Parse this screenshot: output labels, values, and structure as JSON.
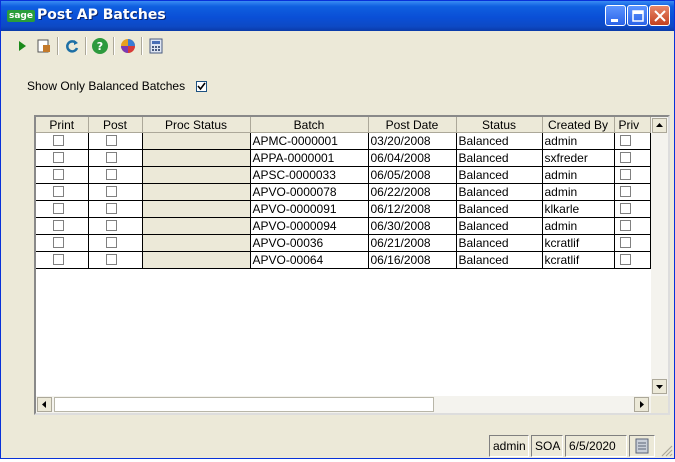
{
  "window": {
    "title": "Post AP Batches",
    "logo_text": "sage"
  },
  "toolbar": {
    "buttons": [
      "play-icon",
      "print-preview-icon",
      "refresh-icon",
      "help-icon",
      "color-wheel-icon",
      "calculator-icon"
    ]
  },
  "filter": {
    "label": "Show Only Balanced Batches",
    "checked": true
  },
  "grid": {
    "columns": [
      "Print",
      "Post",
      "Proc Status",
      "Batch",
      "Post Date",
      "Status",
      "Created By",
      "Priv"
    ],
    "rows": [
      {
        "batch": "APMC-0000001",
        "post_date": "03/20/2008",
        "status": "Balanced",
        "created_by": "admin"
      },
      {
        "batch": "APPA-0000001",
        "post_date": "06/04/2008",
        "status": "Balanced",
        "created_by": "sxfreder"
      },
      {
        "batch": "APSC-0000033",
        "post_date": "06/05/2008",
        "status": "Balanced",
        "created_by": "admin"
      },
      {
        "batch": "APVO-0000078",
        "post_date": "06/22/2008",
        "status": "Balanced",
        "created_by": "admin"
      },
      {
        "batch": "APVO-0000091",
        "post_date": "06/12/2008",
        "status": "Balanced",
        "created_by": "klkarle"
      },
      {
        "batch": "APVO-0000094",
        "post_date": "06/30/2008",
        "status": "Balanced",
        "created_by": "admin"
      },
      {
        "batch": "APVO-00036",
        "post_date": "06/21/2008",
        "status": "Balanced",
        "created_by": "kcratlif"
      },
      {
        "batch": "APVO-00064",
        "post_date": "06/16/2008",
        "status": "Balanced",
        "created_by": "kcratlif"
      }
    ]
  },
  "statusbar": {
    "user": "admin",
    "company": "SOA",
    "date": "6/5/2020"
  }
}
